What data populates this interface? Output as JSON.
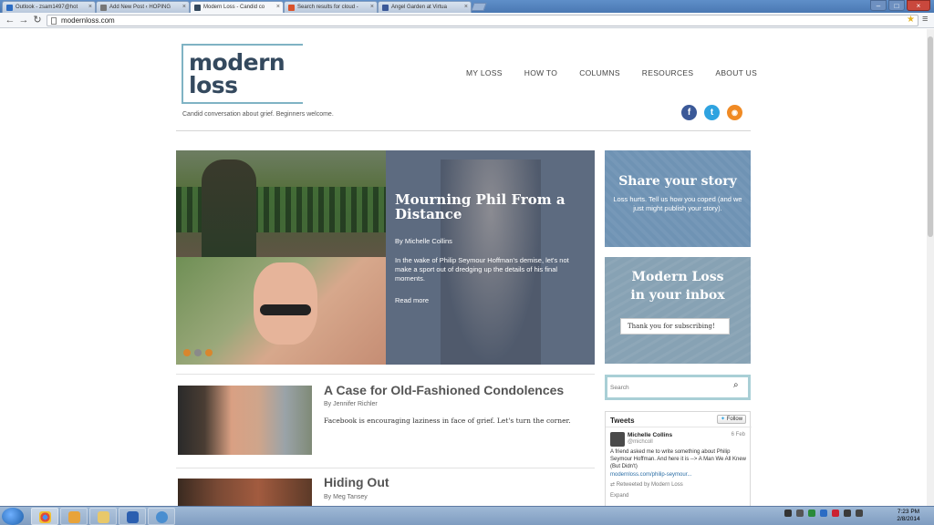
{
  "browser": {
    "tabs": [
      {
        "title": "Outlook - zsam1497@hot",
        "icon_color": "#2b6cc4",
        "icon": "outlook-icon"
      },
      {
        "title": "Add New Post ‹ HOPING",
        "icon_color": "#777777",
        "icon": "wordpress-icon"
      },
      {
        "title": "Modern Loss - Candid co",
        "icon_color": "#34495e",
        "icon": "modern-loss-icon"
      },
      {
        "title": "Search results for cloud -",
        "icon_color": "#d9532c",
        "icon": "office-icon"
      },
      {
        "title": "Angel Garden at Virtua",
        "icon_color": "#3b5998",
        "icon": "facebook-icon"
      }
    ],
    "active_tab": 2,
    "url": "modernloss.com"
  },
  "site": {
    "logo_line1": "modern",
    "logo_line2": "loss",
    "tagline": "Candid conversation about grief. Beginners welcome.",
    "nav": [
      "MY LOSS",
      "HOW TO",
      "COLUMNS",
      "RESOURCES",
      "ABOUT US"
    ],
    "social": {
      "facebook": "f",
      "twitter": "t",
      "rss": "◉"
    }
  },
  "feature": {
    "title": "Mourning Phil From a Distance",
    "byline": "By Michelle Collins",
    "excerpt": "In the wake of Philip Seymour Hoffman's demise, let's not make a sport out of dredging up the details of his final moments.",
    "more": "Read more"
  },
  "sidebar": {
    "share_title": "Share your story",
    "share_text": "Loss hurts. Tell us how you coped (and we just might publish your story).",
    "inbox_title_1": "Modern Loss",
    "inbox_title_2": "in your inbox",
    "inbox_thanks": "Thank you for subscribing!",
    "search_placeholder": "Search"
  },
  "tweets": {
    "header": "Tweets",
    "follow": "Follow",
    "name": "Michelle Collins",
    "handle": "@michcoll",
    "date": "6 Feb",
    "text": "A friend asked me to write something about Philip Seymour Hoffman. And here it is --> A Man We All Knew (But Didn't)",
    "link": "modernloss.com/philip-seymour...",
    "retweeted": "Retweeted by Modern Loss",
    "expand": "Expand"
  },
  "posts": [
    {
      "title": "A Case for Old-Fashioned Condolences",
      "byline": "By Jennifer Richler",
      "excerpt": "Facebook is encouraging laziness in face of grief. Let's turn the corner."
    },
    {
      "title": "Hiding Out",
      "byline": "By Meg Tansey",
      "excerpt": ""
    }
  ],
  "taskbar": {
    "time": "7:23 PM",
    "date": "2/8/2014"
  }
}
